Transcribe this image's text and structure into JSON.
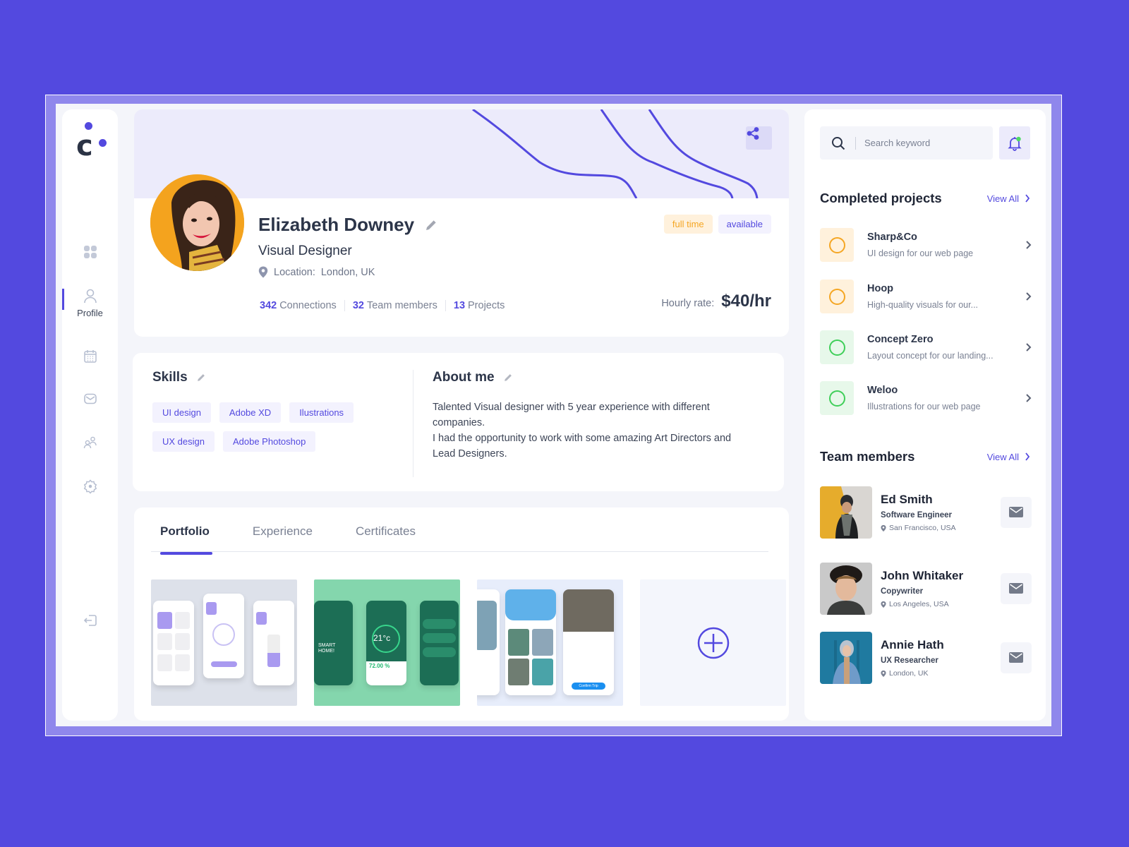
{
  "brand": {
    "logo_letter": "c"
  },
  "sidebar": {
    "items": [
      {
        "id": "dashboard",
        "icon": "grid-icon",
        "label": ""
      },
      {
        "id": "profile",
        "icon": "user-icon",
        "label": "Profile",
        "active": true
      },
      {
        "id": "calendar",
        "icon": "calendar-icon",
        "label": ""
      },
      {
        "id": "messages",
        "icon": "mail-icon",
        "label": ""
      },
      {
        "id": "team",
        "icon": "users-icon",
        "label": ""
      },
      {
        "id": "settings",
        "icon": "gear-icon",
        "label": ""
      },
      {
        "id": "logout",
        "icon": "logout-icon",
        "label": ""
      }
    ]
  },
  "profile": {
    "name": "Elizabeth Downey",
    "title": "Visual Designer",
    "location_label": "Location:",
    "location": "London, UK",
    "badges": [
      {
        "label": "full time",
        "color": "#f5a623"
      },
      {
        "label": "available",
        "color": "#5349df"
      }
    ],
    "stats": [
      {
        "value": "342",
        "label": "Connections"
      },
      {
        "value": "32",
        "label": "Team members"
      },
      {
        "value": "13",
        "label": "Projects"
      }
    ],
    "hourly_rate_label": "Hourly rate:",
    "hourly_rate": "$40/hr"
  },
  "skills": {
    "title": "Skills",
    "items": [
      "UI design",
      "Adobe XD",
      "Ilustrations",
      "UX design",
      "Adobe Photoshop"
    ]
  },
  "about": {
    "title": "About me",
    "text": "Talented Visual designer with 5 year experience with different companies.\nI had the opportunity to work with some amazing Art Directors and Lead Designers."
  },
  "portfolio": {
    "tabs": [
      {
        "label": "Portfolio",
        "active": true
      },
      {
        "label": "Experience"
      },
      {
        "label": "Certificates"
      }
    ],
    "thumbnails": [
      {
        "name": "smart-home-purple-app"
      },
      {
        "name": "smart-home-green-app",
        "caption": "SMART HOME!",
        "reading": "21°c",
        "stat": "72.00 %"
      },
      {
        "name": "travel-booking-app",
        "button": "Confirm Trip"
      }
    ]
  },
  "search": {
    "placeholder": "Search keyword",
    "value": ""
  },
  "notifications": {
    "has_unread": true,
    "dot_color": "#4cd964"
  },
  "completed_projects": {
    "title": "Completed projects",
    "view_all": "View All",
    "items": [
      {
        "name": "Sharp&Co",
        "desc": "UI design for our web page",
        "color": "#f5a623",
        "bg": "#fff1dc"
      },
      {
        "name": "Hoop",
        "desc": "High-quality visuals for our...",
        "color": "#f5a623",
        "bg": "#fff1dc"
      },
      {
        "name": "Concept Zero",
        "desc": "Layout concept for our landing...",
        "color": "#3fcf59",
        "bg": "#e7f8ea"
      },
      {
        "name": "Weloo",
        "desc": "Illustrations for our web page",
        "color": "#3fcf59",
        "bg": "#e7f8ea"
      }
    ]
  },
  "team_members": {
    "title": "Team members",
    "view_all": "View All",
    "items": [
      {
        "name": "Ed Smith",
        "role": "Software Engineer",
        "location": "San Francisco, USA"
      },
      {
        "name": "John Whitaker",
        "role": "Copywriter",
        "location": "Los Angeles, USA"
      },
      {
        "name": "Annie Hath",
        "role": "UX Researcher",
        "location": "London, UK"
      }
    ]
  },
  "colors": {
    "accent": "#5349df",
    "background": "#5349df",
    "text_dark": "#2c3549",
    "muted": "#7a8193"
  }
}
